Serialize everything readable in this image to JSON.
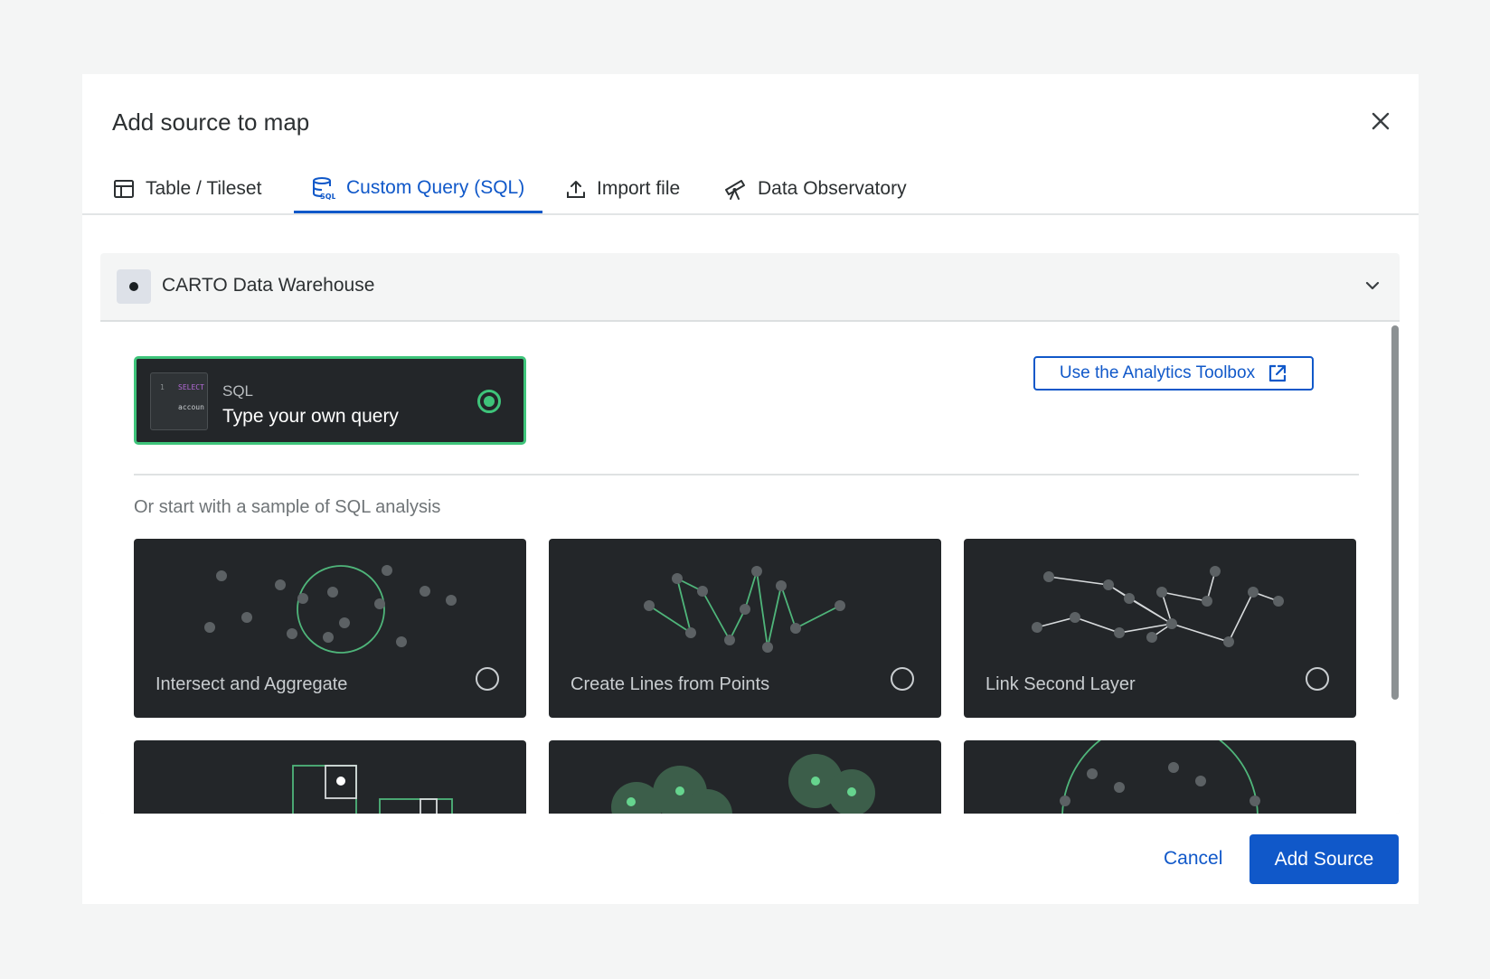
{
  "dialog": {
    "title": "Add source to map",
    "close_icon": "close-icon"
  },
  "tabs": [
    {
      "label": "Table / Tileset",
      "icon": "table-icon",
      "active": false
    },
    {
      "label": "Custom Query (SQL)",
      "icon": "sql-database-icon",
      "active": true
    },
    {
      "label": "Import file",
      "icon": "upload-icon",
      "active": false
    },
    {
      "label": "Data Observatory",
      "icon": "telescope-icon",
      "active": false
    }
  ],
  "connection": {
    "label": "CARTO Data Warehouse",
    "icon": "connection-icon",
    "expand_icon": "chevron-down-icon"
  },
  "sql_option": {
    "kicker": "SQL",
    "title": "Type your own query",
    "thumb_line": "1",
    "thumb_keyword": "SELECT",
    "thumb_text": "accoun",
    "selected": true
  },
  "toolbox_button": {
    "label": "Use the Analytics Toolbox",
    "icon": "external-link-icon"
  },
  "samples": {
    "heading": "Or start with a sample of SQL analysis",
    "items": [
      {
        "label": "Intersect and Aggregate",
        "selected": false
      },
      {
        "label": "Create Lines from Points",
        "selected": false
      },
      {
        "label": "Link Second Layer",
        "selected": false
      },
      {
        "label": "",
        "selected": false
      },
      {
        "label": "",
        "selected": false
      },
      {
        "label": "",
        "selected": false
      }
    ]
  },
  "footer": {
    "cancel_label": "Cancel",
    "add_label": "Add Source"
  },
  "colors": {
    "accent": "#1058c9",
    "selected_green": "#3ec47a",
    "card_dark": "#232629"
  }
}
